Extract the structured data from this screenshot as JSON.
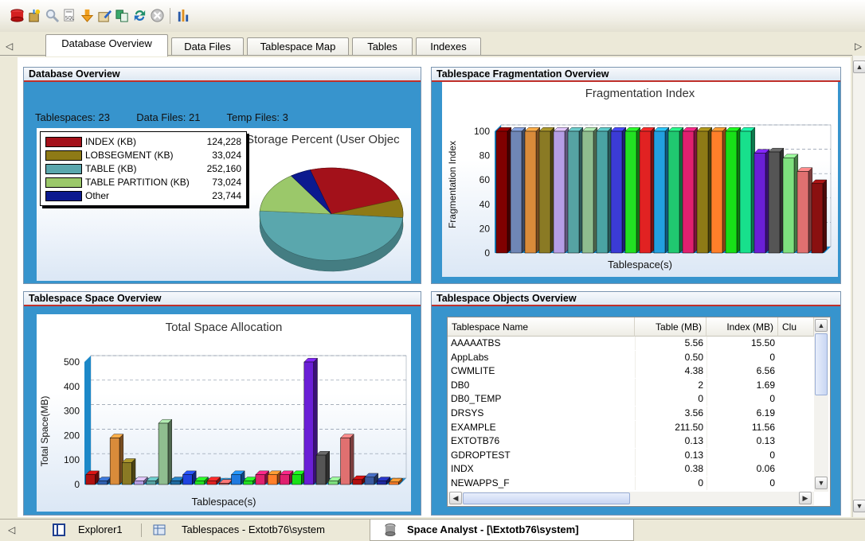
{
  "toolbar": {
    "icons": [
      "database-icon",
      "wizard-icon",
      "search-icon",
      "sql-icon",
      "arrow-down-icon",
      "edit-icon",
      "copy-icon",
      "refresh-icon",
      "stop-icon",
      "analyze-icon"
    ]
  },
  "tabs": {
    "scroll_left": "◁",
    "scroll_right": "▷",
    "items": [
      {
        "label": "Database Overview",
        "active": true
      },
      {
        "label": "Data Files",
        "active": false
      },
      {
        "label": "Tablespace Map",
        "active": false
      },
      {
        "label": "Tables",
        "active": false
      },
      {
        "label": "Indexes",
        "active": false
      }
    ]
  },
  "db_overview": {
    "title": "Database Overview",
    "tablespaces_label": "Tablespaces:",
    "tablespaces_value": "23",
    "datafiles_label": "Data Files:",
    "datafiles_value": "21",
    "tempfiles_label": "Temp Files:",
    "tempfiles_value": "3",
    "chart_title": "Storage Percent (User Objec",
    "legend": [
      {
        "label": "INDEX (KB)",
        "value": "124,228",
        "color": "#a3111a"
      },
      {
        "label": "LOBSEGMENT (KB)",
        "value": "33,024",
        "color": "#8e7a16"
      },
      {
        "label": "TABLE (KB)",
        "value": "252,160",
        "color": "#5aa7ad"
      },
      {
        "label": "TABLE PARTITION (KB)",
        "value": "73,024",
        "color": "#9bc86a"
      },
      {
        "label": "Other",
        "value": "23,744",
        "color": "#0c1a8f"
      }
    ]
  },
  "frag": {
    "title": "Tablespace Fragmentation Overview",
    "chart_title": "Fragmentation Index",
    "ylabel": "Fragmentation Index",
    "xlabel": "Tablespace(s)",
    "yticks": [
      "0",
      "20",
      "40",
      "60",
      "80",
      "100"
    ]
  },
  "space": {
    "title": "Tablespace Space Overview",
    "chart_title": "Total Space Allocation",
    "ylabel": "Total Space(MB)",
    "xlabel": "Tablespace(s)",
    "yticks": [
      "0",
      "100",
      "200",
      "300",
      "400",
      "500"
    ]
  },
  "objects": {
    "title": "Tablespace Objects Overview",
    "columns": [
      "Tablespace Name",
      "Table (MB)",
      "Index (MB)",
      "Clu"
    ],
    "rows": [
      [
        "AAAAATBS",
        "5.56",
        "15.50"
      ],
      [
        "AppLabs",
        "0.50",
        "0"
      ],
      [
        "CWMLITE",
        "4.38",
        "6.56"
      ],
      [
        "DB0",
        "2",
        "1.69"
      ],
      [
        "DB0_TEMP",
        "0",
        "0"
      ],
      [
        "DRSYS",
        "3.56",
        "6.19"
      ],
      [
        "EXAMPLE",
        "211.50",
        "11.56"
      ],
      [
        "EXTOTB76",
        "0.13",
        "0.13"
      ],
      [
        "GDROPTEST",
        "0.13",
        "0"
      ],
      [
        "INDX",
        "0.38",
        "0.06"
      ],
      [
        "NEWAPPS_F",
        "0",
        "0"
      ]
    ]
  },
  "bottom_tabs": [
    {
      "label": "Explorer1"
    },
    {
      "label": "Tablespaces - Extotb76\\system"
    },
    {
      "label": "Space Analyst - [\\Extotb76\\system]"
    }
  ],
  "chart_data": [
    {
      "type": "pie",
      "title": "Storage Percent (User Objec",
      "categories": [
        "INDEX (KB)",
        "LOBSEGMENT (KB)",
        "TABLE (KB)",
        "TABLE PARTITION (KB)",
        "Other"
      ],
      "values": [
        124228,
        33024,
        252160,
        73024,
        23744
      ],
      "colors": [
        "#a3111a",
        "#8e7a16",
        "#5aa7ad",
        "#9bc86a",
        "#0c1a8f"
      ]
    },
    {
      "type": "bar",
      "title": "Fragmentation Index",
      "xlabel": "Tablespace(s)",
      "ylabel": "Fragmentation Index",
      "ylim": [
        0,
        100
      ],
      "values": [
        100,
        100,
        100,
        100,
        100,
        100,
        100,
        100,
        100,
        100,
        100,
        100,
        100,
        100,
        100,
        100,
        100,
        100,
        82,
        83,
        78,
        67,
        57
      ],
      "colors": [
        "#800000",
        "#6f86b6",
        "#d98b3a",
        "#8a7a24",
        "#b59ee6",
        "#56a3a3",
        "#8fbd8f",
        "#4aa3a3",
        "#3b3bd6",
        "#22e022",
        "#e12222",
        "#22a0e0",
        "#20c870",
        "#e0206f",
        "#8e7a16",
        "#ff7f2a",
        "#18e018",
        "#18e08c",
        "#6a1fd6",
        "#555555",
        "#7ee07e",
        "#e07070",
        "#8a1010"
      ]
    },
    {
      "type": "bar",
      "title": "Total Space Allocation",
      "xlabel": "Tablespace(s)",
      "ylabel": "Total Space(MB)",
      "ylim": [
        0,
        500
      ],
      "values": [
        40,
        15,
        190,
        90,
        15,
        15,
        250,
        15,
        40,
        15,
        15,
        5,
        40,
        15,
        40,
        40,
        40,
        40,
        520,
        120,
        15,
        190,
        20,
        30,
        15,
        10
      ],
      "colors": [
        "#b01010",
        "#3060b0",
        "#d98b3a",
        "#8a7a24",
        "#b59ee6",
        "#56a3a3",
        "#8fbd8f",
        "#1f6aa0",
        "#1f44e0",
        "#22e022",
        "#e12222",
        "#d06060",
        "#1f7ae0",
        "#22e022",
        "#e0206f",
        "#ff7f2a",
        "#e0206f",
        "#18e018",
        "#6a1fd6",
        "#555555",
        "#7ee07e",
        "#e07070",
        "#b01010",
        "#3a5aa0",
        "#1f2aa0",
        "#ff7f2a"
      ]
    }
  ]
}
